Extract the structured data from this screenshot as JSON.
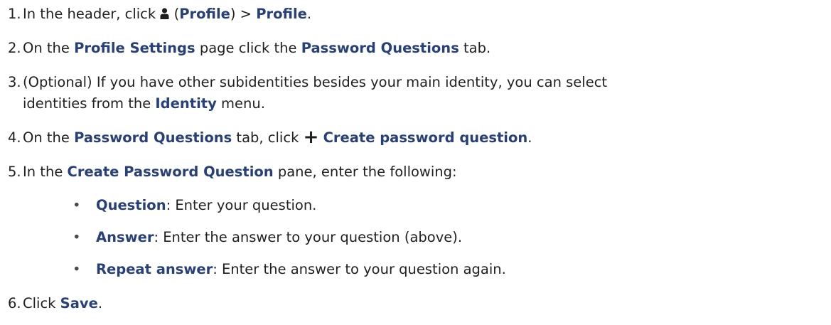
{
  "steps": [
    {
      "number": "1.",
      "parts": [
        {
          "t": "In the header, click ",
          "b": false
        },
        {
          "icon": "profile-person-icon"
        },
        {
          "t": " (",
          "b": false
        },
        {
          "t": "Profile",
          "b": true
        },
        {
          "t": ") > ",
          "b": false
        },
        {
          "t": "Profile",
          "b": true
        },
        {
          "t": ".",
          "b": false
        }
      ]
    },
    {
      "number": "2.",
      "parts": [
        {
          "t": "On the ",
          "b": false
        },
        {
          "t": "Profile Settings",
          "b": true
        },
        {
          "t": " page click the ",
          "b": false
        },
        {
          "t": "Password Questions",
          "b": true
        },
        {
          "t": " tab.",
          "b": false
        }
      ]
    },
    {
      "number": "3.",
      "parts": [
        {
          "t": "(Optional) If you have other subidentities besides your main identity, you can select",
          "b": false
        }
      ],
      "continuation": [
        {
          "t": "identities from the ",
          "b": false
        },
        {
          "t": "Identity",
          "b": true
        },
        {
          "t": " menu.",
          "b": false
        }
      ]
    },
    {
      "number": "4.",
      "parts": [
        {
          "t": "On the ",
          "b": false
        },
        {
          "t": "Password Questions",
          "b": true
        },
        {
          "t": " tab, click ",
          "b": false
        },
        {
          "icon": "plus-icon"
        },
        {
          "t": " ",
          "b": false
        },
        {
          "t": "Create password question",
          "b": true
        },
        {
          "t": ".",
          "b": false
        }
      ]
    },
    {
      "number": "5.",
      "parts": [
        {
          "t": "In the ",
          "b": false
        },
        {
          "t": "Create Password Question",
          "b": true
        },
        {
          "t": " pane, enter the following:",
          "b": false
        }
      ],
      "bullets": [
        [
          {
            "t": "Question",
            "b": true
          },
          {
            "t": ": Enter your question.",
            "b": false
          }
        ],
        [
          {
            "t": "Answer",
            "b": true
          },
          {
            "t": ": Enter the answer to your question (above).",
            "b": false
          }
        ],
        [
          {
            "t": "Repeat answer",
            "b": true
          },
          {
            "t": ": Enter the answer to your question again.",
            "b": false
          }
        ]
      ]
    },
    {
      "number": "6.",
      "parts": [
        {
          "t": "Click ",
          "b": false
        },
        {
          "t": "Save",
          "b": true
        },
        {
          "t": ".",
          "b": false
        }
      ]
    }
  ],
  "bullet_glyph": "•",
  "colors": {
    "emphasis": "#27407a",
    "text": "#1f1f1f"
  }
}
